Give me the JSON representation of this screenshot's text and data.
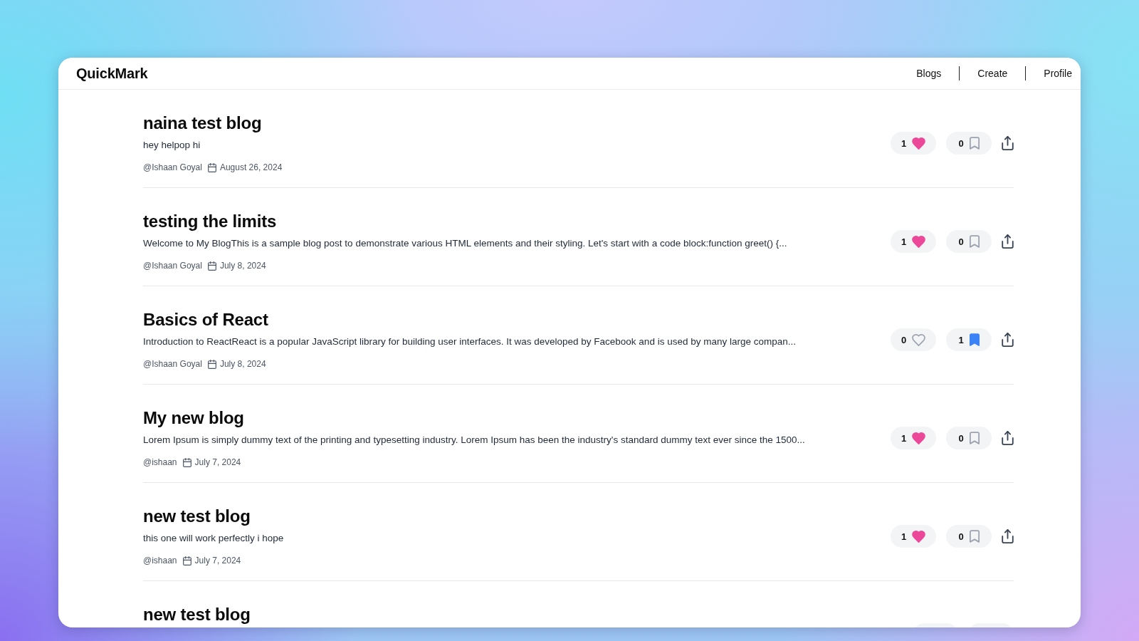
{
  "app": {
    "brand": "QuickMark"
  },
  "nav": [
    {
      "label": "Blogs"
    },
    {
      "label": "Create"
    },
    {
      "label": "Profile"
    }
  ],
  "posts": [
    {
      "title": "naina test blog",
      "excerpt": "hey helpop hi",
      "author": "@Ishaan Goyal",
      "date": "August 26, 2024",
      "likes": "1",
      "liked": true,
      "bookmarks": "0",
      "bookmarked": false
    },
    {
      "title": "testing the limits",
      "excerpt": "Welcome to My BlogThis is a sample blog post to demonstrate various HTML elements and their styling. Let's start with a code block:function greet() {...",
      "author": "@Ishaan Goyal",
      "date": "July 8, 2024",
      "likes": "1",
      "liked": true,
      "bookmarks": "0",
      "bookmarked": false
    },
    {
      "title": "Basics of React",
      "excerpt": "Introduction to ReactReact is a popular JavaScript library for building user interfaces. It was developed by Facebook and is used by many large compan...",
      "author": "@Ishaan Goyal",
      "date": "July 8, 2024",
      "likes": "0",
      "liked": false,
      "bookmarks": "1",
      "bookmarked": true
    },
    {
      "title": "My new blog",
      "excerpt": "Lorem Ipsum is simply dummy text of the printing and typesetting industry. Lorem Ipsum has been the industry's standard dummy text ever since the 1500...",
      "author": "@ishaan",
      "date": "July 7, 2024",
      "likes": "1",
      "liked": true,
      "bookmarks": "0",
      "bookmarked": false
    },
    {
      "title": "new test blog",
      "excerpt": "this one will work perfectly i hope",
      "author": "@ishaan",
      "date": "July 7, 2024",
      "likes": "1",
      "liked": true,
      "bookmarks": "0",
      "bookmarked": false
    },
    {
      "title": "new test blog"
    }
  ]
}
